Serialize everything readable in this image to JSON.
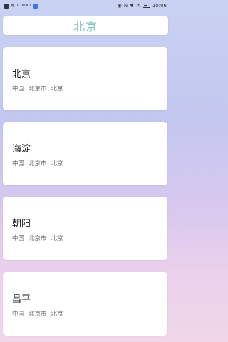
{
  "status_bar": {
    "left_icons": [
      "sim-icon",
      "wifi-icon",
      "data-speed-icon",
      "notification-icon"
    ],
    "speed_text": "0.00\nK/s",
    "right_icons": [
      "eye-icon",
      "nfc-icon",
      "bluetooth-icon",
      "close-icon",
      "battery-icon"
    ],
    "time": "10:06"
  },
  "search": {
    "value": "北京"
  },
  "results": [
    {
      "name": "北京",
      "country": "中国",
      "province": "北京市",
      "city": "北京"
    },
    {
      "name": "海淀",
      "country": "中国",
      "province": "北京市",
      "city": "北京"
    },
    {
      "name": "朝阳",
      "country": "中国",
      "province": "北京市",
      "city": "北京"
    },
    {
      "name": "昌平",
      "country": "中国",
      "province": "北京市",
      "city": "北京"
    }
  ]
}
